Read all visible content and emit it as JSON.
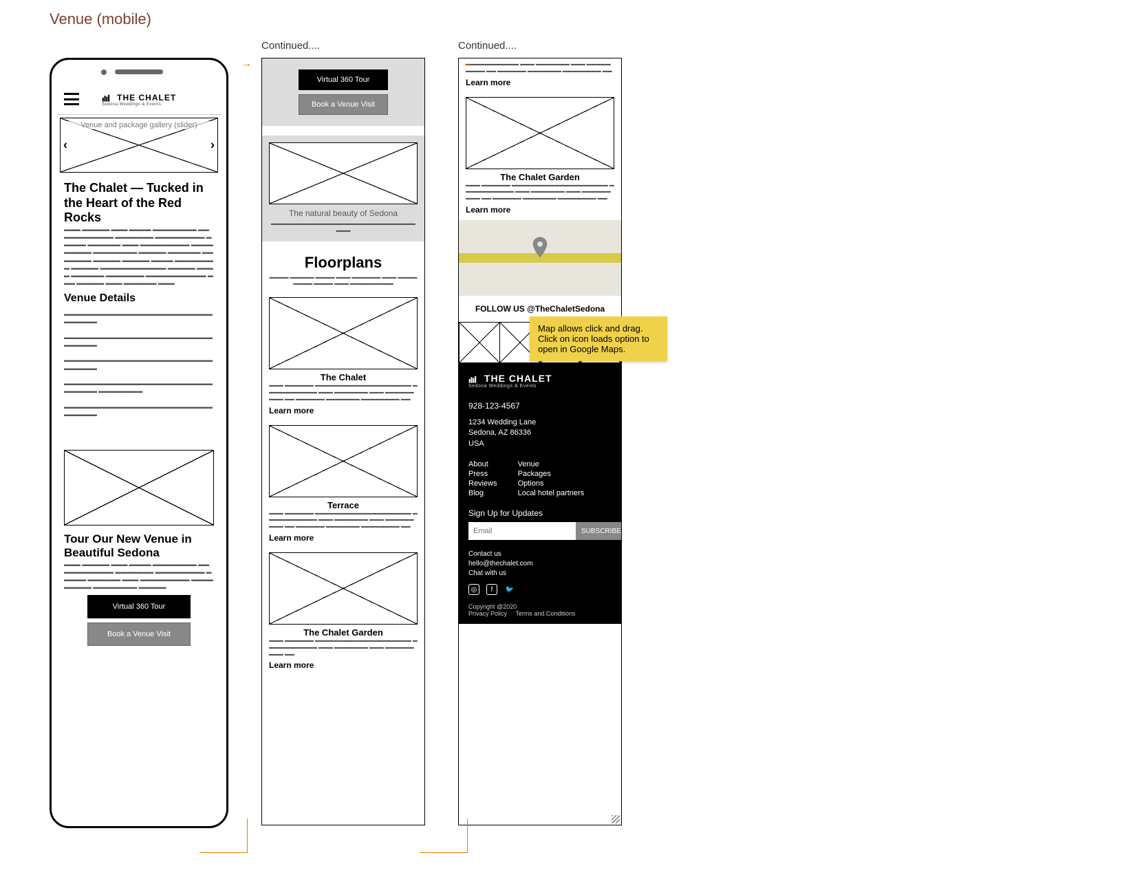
{
  "page_title": "Venue (mobile)",
  "continued_label": "Continued....",
  "header": {
    "brand_top": "THE",
    "brand_main": "CHALET",
    "brand_tag": "Sedona Weddings & Events"
  },
  "gallery_label": "Venue and package gallery (slider)",
  "hero": {
    "title": "The Chalet — Tucked in the Heart of the Red Rocks",
    "details_title": "Venue Details"
  },
  "tour_cta": {
    "title": "Tour Our New Venue in Beautiful Sedona",
    "btn_360": "Virtual 360 Tour",
    "btn_book": "Book a Venue Visit"
  },
  "sedona_caption": "The natural beauty of Sedona",
  "floorplans": {
    "title": "Floorplans",
    "items": [
      {
        "name": "The Chalet",
        "learn": "Learn more"
      },
      {
        "name": "Terrace",
        "learn": "Learn more"
      },
      {
        "name": "The Chalet Garden",
        "learn": "Learn more"
      }
    ],
    "garden2_name": "The Chalet Garden",
    "garden2_learn": "Learn more"
  },
  "learn_more_top": "Learn more",
  "follow": "FOLLOW US @TheChaletSedona",
  "map_annotation": "Map allows click and drag. Click on icon loads option to open in Google Maps.",
  "footer": {
    "phone": "928-123-4567",
    "addr1": "1234 Wedding Lane",
    "addr2": "Sedona, AZ 86336",
    "addr3": "USA",
    "links_col1": [
      "About",
      "Press",
      "Reviews",
      "Blog"
    ],
    "links_col2": [
      "Venue",
      "Packages",
      "Options",
      "Local hotel partners"
    ],
    "signup_label": "Sign Up for Updates",
    "email_placeholder": "Email",
    "subscribe": "SUBSCRIBE",
    "contact_title": "Contact us",
    "contact_email": "hello@thechalet.com",
    "contact_chat": "Chat with us",
    "copyright": "Copyright @2020",
    "privacy": "Privacy Policy",
    "terms": "Terms and Conditions"
  }
}
